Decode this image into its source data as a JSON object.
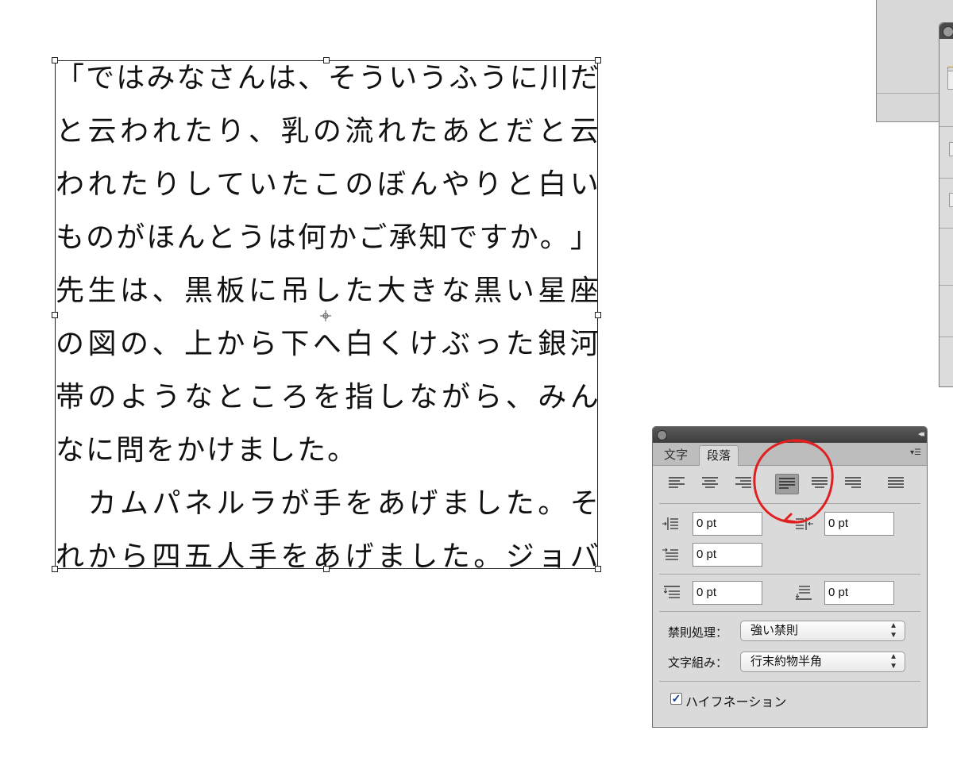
{
  "text_frame": {
    "lines": [
      "「ではみなさんは、そういうふうに川だ",
      "と云われたり、乳の流れたあとだと云",
      "われたりしていたこのぼんやりと白い",
      "ものがほんとうは何かご承知ですか。」",
      "先生は、黒板に吊した大きな黒い星座",
      "の図の、上から下へ白くけぶった銀河",
      "帯のようなところを指しながら、みん",
      "なに問をかけました。",
      "　カムパネルラが手をあげました。そ",
      "れから四五人手をあげました。ジョバ"
    ]
  },
  "paragraph_panel": {
    "tabs": [
      "文字",
      "段落"
    ],
    "active_tab": "段落",
    "alignment_buttons": [
      {
        "name": "align-left",
        "selected": false
      },
      {
        "name": "align-center",
        "selected": false
      },
      {
        "name": "align-right",
        "selected": false
      },
      {
        "name": "justify-last-left",
        "selected": true
      },
      {
        "name": "justify-last-center",
        "selected": false
      },
      {
        "name": "justify-last-right",
        "selected": false
      },
      {
        "name": "justify-all",
        "selected": false
      }
    ],
    "left_indent": "0 pt",
    "right_indent": "0 pt",
    "first_line_indent": "0 pt",
    "space_before": "0 pt",
    "space_after": "0 pt",
    "kinsoku_label": "禁則処理：",
    "kinsoku_value": "強い禁則",
    "mojikumi_label": "文字組み：",
    "mojikumi_value": "行末約物半角",
    "hyphenation_label": "ハイフネーション",
    "hyphenation_checked": true
  },
  "colors": {
    "annotation": "#e02020",
    "panel_bg": "#dadada"
  }
}
